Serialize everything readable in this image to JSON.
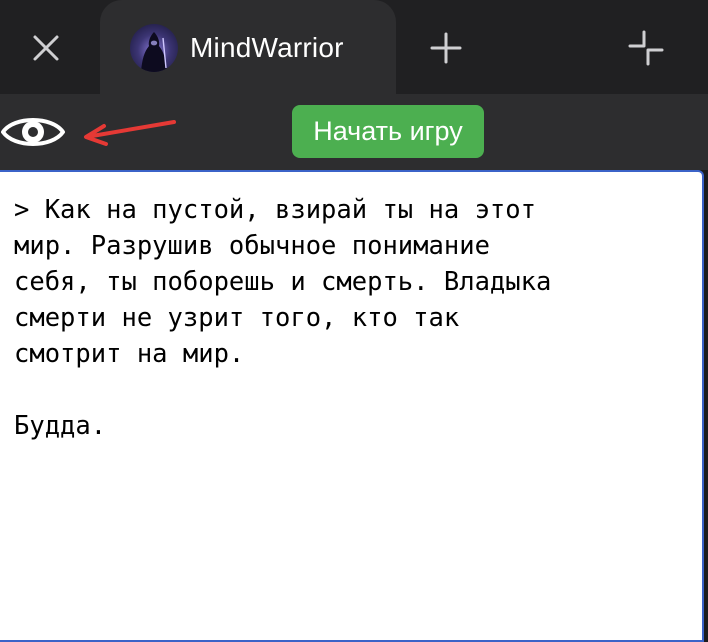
{
  "tabbar": {
    "close_icon": "close-icon",
    "active_tab": {
      "title": "MindWarrior",
      "avatar_icon": "warrior-avatar"
    },
    "new_tab_icon": "plus-icon",
    "collapse_icon": "collapse-icon"
  },
  "toolbar": {
    "eye_icon": "eye-icon",
    "annotation_arrow_color": "#e53935",
    "start_button_label": "Начать игру",
    "start_button_color": "#4caf50"
  },
  "editor": {
    "text": "> Как на пустой, взирай ты на этот\nмир. Разрушив обычное понимание\nсебя, ты поборешь и смерть. Владыка\nсмерти не узрит того, кто так\nсмотрит на мир.\n\nБудда.",
    "border_color": "#3b63c8"
  }
}
